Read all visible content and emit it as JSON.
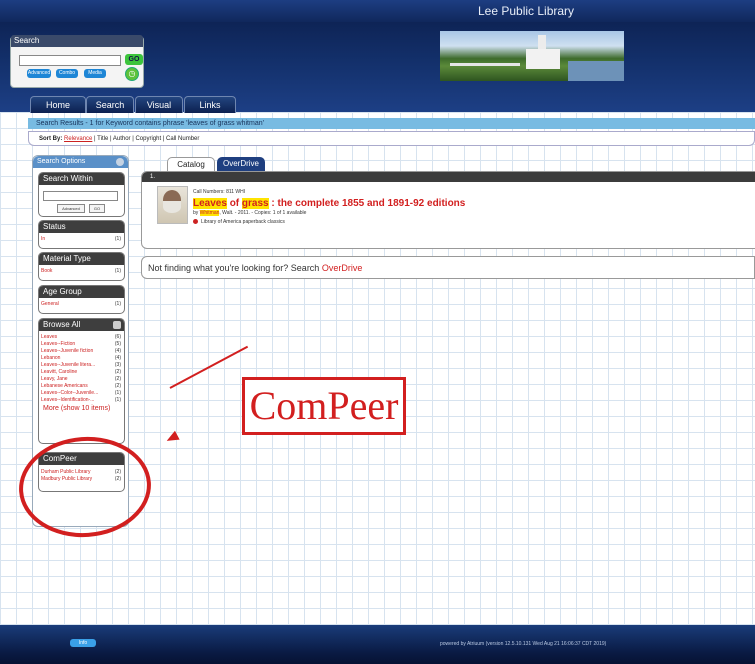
{
  "header": {
    "title": "Lee Public Library"
  },
  "search_widget": {
    "caption": "Search",
    "go_label": "GO",
    "buttons": [
      "Advanced",
      "Combo",
      "Media"
    ]
  },
  "nav": {
    "tabs": [
      "Home",
      "Search",
      "Visual",
      "Links"
    ]
  },
  "results": {
    "summary": "Search Results - 1 for Keyword contains phrase 'leaves of grass whitman'",
    "sort_by_label": "Sort By:",
    "sort_options": [
      "Relevance",
      "Title",
      "Author",
      "Copyright",
      "Call Number"
    ]
  },
  "sidebar": {
    "header": "Search Options",
    "search_within": {
      "title": "Search Within",
      "advanced": "Advanced",
      "go": "GO"
    },
    "status": {
      "title": "Status",
      "items": [
        {
          "label": "In",
          "count": "(1)"
        }
      ]
    },
    "material_type": {
      "title": "Material Type",
      "items": [
        {
          "label": "Book",
          "count": "(1)"
        }
      ]
    },
    "age_group": {
      "title": "Age Group",
      "items": [
        {
          "label": "General",
          "count": "(1)"
        }
      ]
    },
    "browse_all": {
      "title": "Browse All",
      "items": [
        {
          "label": "Leaves",
          "count": "(6)"
        },
        {
          "label": "Leaves--Fiction",
          "count": "(5)"
        },
        {
          "label": "Leaves--Juvenile fiction",
          "count": "(4)"
        },
        {
          "label": "Lebanon",
          "count": "(4)"
        },
        {
          "label": "Leaves--Juvenile litera...",
          "count": "(3)"
        },
        {
          "label": "Leavitt, Caroline",
          "count": "(2)"
        },
        {
          "label": "Leavy, Jane",
          "count": "(2)"
        },
        {
          "label": "Lebanese Americans",
          "count": "(2)"
        },
        {
          "label": "Leaves--Color--Juvenile...",
          "count": "(1)"
        },
        {
          "label": "Leaves--Identification-...",
          "count": "(1)"
        }
      ],
      "more": "More (show 10 items)"
    },
    "compeer": {
      "title": "ComPeer",
      "items": [
        {
          "label": "Durham Public Library",
          "count": "(2)"
        },
        {
          "label": "Madbury Public Library",
          "count": "(2)"
        }
      ]
    }
  },
  "content_tabs": [
    "Catalog",
    "OverDrive"
  ],
  "result_card": {
    "number": "1.",
    "call_number": "Call Numbers: 811 WHI",
    "title_parts": [
      "Leaves",
      " of ",
      "grass",
      " : the complete 1855 and 1891-92 editions"
    ],
    "by_prefix": "by ",
    "author": "Whitman",
    "by_suffix": ", Walt. - 2011. - Copies: 1 of 1 available",
    "series": "Library of America paperback classics"
  },
  "not_finding": {
    "text": "Not finding what you're looking for? Search ",
    "link": "OverDrive"
  },
  "annotation": {
    "label": "ComPeer",
    "color": "#d21f1f"
  },
  "footer": {
    "info_label": "Info",
    "powered": "powered by Atriuum (version 12.5.10.131 Wed Aug 21 16:06:37 CDT 2019)"
  }
}
